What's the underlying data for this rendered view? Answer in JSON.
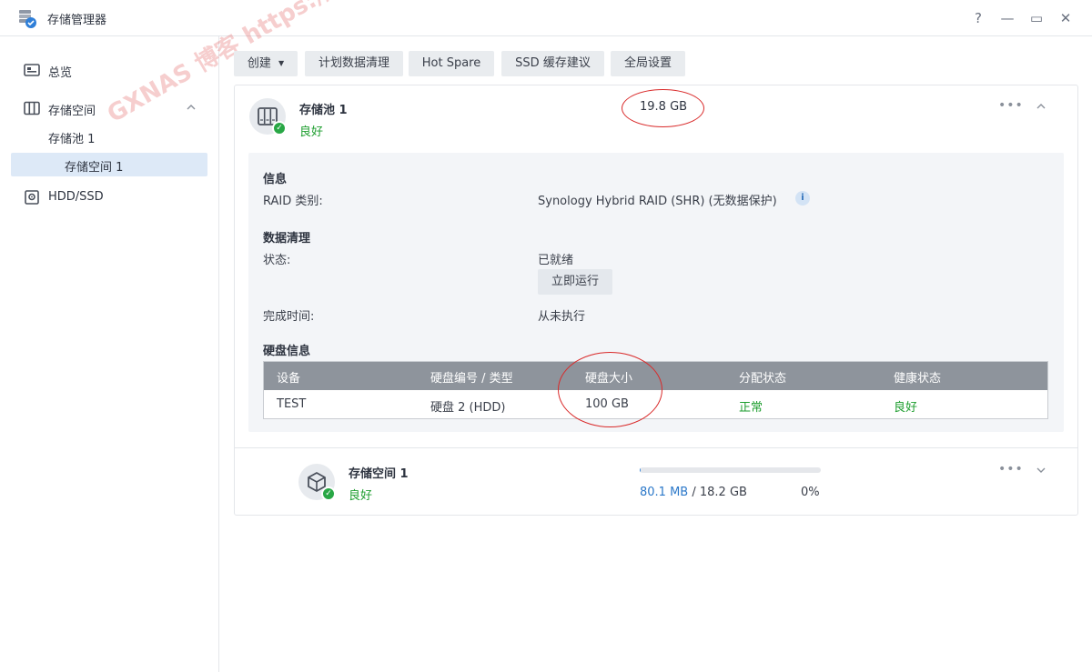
{
  "window": {
    "title": "存储管理器",
    "help": "?",
    "minimize": "—",
    "maximize": "▭",
    "close": "✕"
  },
  "sidebar": {
    "overview": "总览",
    "storage": "存储空间",
    "pool": "存储池 1",
    "volume": "存储空间 1",
    "hdd": "HDD/SSD"
  },
  "toolbar": {
    "create": "创建",
    "scrub": "计划数据清理",
    "hotspare": "Hot Spare",
    "ssd": "SSD 缓存建议",
    "global": "全局设置"
  },
  "pool": {
    "name": "存储池 1",
    "status": "良好",
    "size": "19.8 GB",
    "info_title": "信息",
    "raid_key": "RAID 类别:",
    "raid_val": "Synology Hybrid RAID (SHR) (无数据保护)",
    "scrub_title": "数据清理",
    "state_key": "状态:",
    "state_val": "已就绪",
    "run_now": "立即运行",
    "done_key": "完成时间:",
    "done_val": "从未执行",
    "disk_title": "硬盘信息",
    "table": {
      "headers": [
        "设备",
        "硬盘编号 / 类型",
        "硬盘大小",
        "分配状态",
        "健康状态"
      ],
      "rows": [
        [
          "TEST",
          "硬盘 2 (HDD)",
          "100 GB",
          "正常",
          "良好"
        ]
      ]
    }
  },
  "volume": {
    "name": "存储空间 1",
    "status": "良好",
    "used": "80.1 MB",
    "separator": " / ",
    "total": "18.2 GB",
    "percent": "0%",
    "usage_fraction": 0.004
  },
  "watermark": "GXNAS 博客  https://wp.gxnas.com",
  "colors": {
    "accent": "#2b78c9",
    "good": "#1e9e2f",
    "table_header": "#8e949c",
    "annotation": "#d92a2a"
  }
}
